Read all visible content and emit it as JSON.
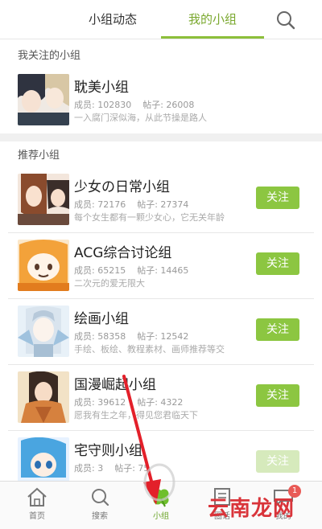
{
  "tabs": [
    {
      "label": "小组动态"
    },
    {
      "label": "我的小组",
      "active": true
    }
  ],
  "icons": {
    "search": "search-icon",
    "home": "home-icon",
    "explore": "search-icon",
    "groups": "clover-icon",
    "forum": "book-icon",
    "me": "chat-icon"
  },
  "colors": {
    "accent": "#8cc641",
    "badge": "#e95a56",
    "arrow": "#e3202a"
  },
  "followed_section": {
    "title": "我关注的小组",
    "groups": [
      {
        "name": "耽美小组",
        "members_label": "成员: 102830",
        "posts_label": "帖子: 26008",
        "desc": "一入腐门深似海，从此节操是路人"
      }
    ]
  },
  "recommended_section": {
    "title": "推荐小组",
    "follow_label": "关注",
    "groups": [
      {
        "name": "少女の日常小组",
        "members_label": "成员: 72176",
        "posts_label": "帖子: 27374",
        "desc": "每个女生都有一颗少女心，它无关年龄"
      },
      {
        "name": "ACG综合讨论组",
        "members_label": "成员: 65215",
        "posts_label": "帖子: 14465",
        "desc": "二次元的爱无限大"
      },
      {
        "name": "绘画小组",
        "members_label": "成员: 58358",
        "posts_label": "帖子: 12542",
        "desc": "手绘、板绘、教程素材、画师推荐等交"
      },
      {
        "name": "国漫崛起小组",
        "members_label": "成员: 39612",
        "posts_label": "帖子: 4322",
        "desc": "愿我有生之年，得见您君临天下"
      },
      {
        "name": "宅守则小组",
        "members_label": "成员: 3",
        "posts_label": "帖子: 75",
        "desc": ""
      }
    ]
  },
  "bottom_nav": {
    "items": [
      {
        "label": "首页"
      },
      {
        "label": "搜索"
      },
      {
        "label": "小组",
        "active": true
      },
      {
        "label": "圈话"
      },
      {
        "label": "我的"
      }
    ],
    "badge": "1"
  },
  "watermark": "云南龙网"
}
